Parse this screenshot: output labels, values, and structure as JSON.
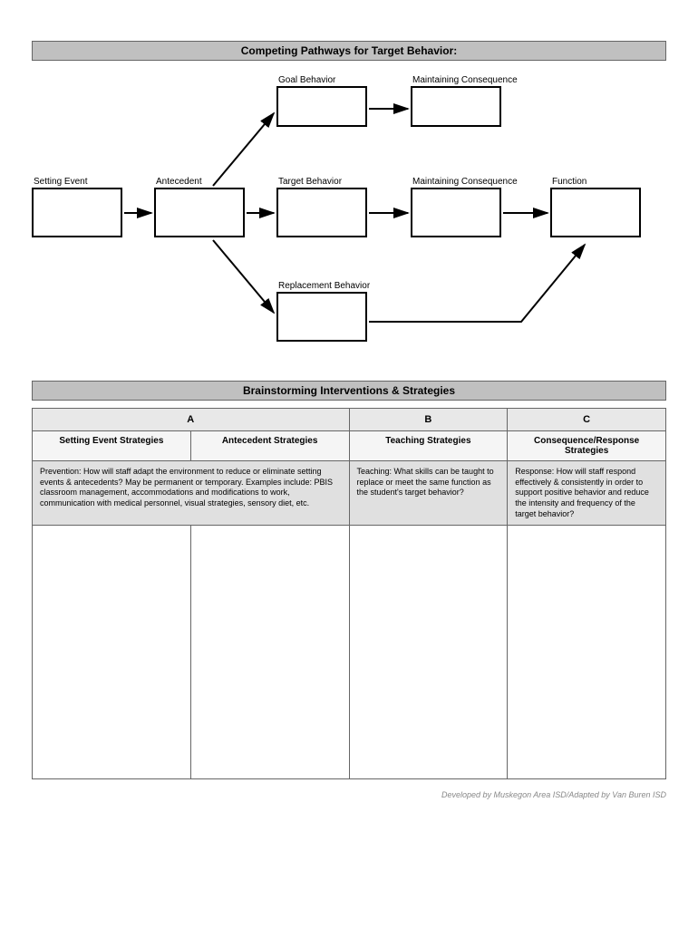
{
  "pathways": {
    "title": "Competing Pathways for Target Behavior:",
    "boxes": {
      "setting_event": "Setting Event",
      "antecedent": "Antecedent",
      "goal_behavior": "Goal Behavior",
      "target_behavior": "Target Behavior",
      "replacement_behavior": "Replacement Behavior",
      "maintaining_consequence_top": "Maintaining Consequence",
      "maintaining_consequence_mid": "Maintaining Consequence",
      "function": "Function"
    }
  },
  "strategies": {
    "title": "Brainstorming Interventions & Strategies",
    "cols": {
      "a": "A",
      "b": "B",
      "c": "C"
    },
    "subs": {
      "setting_event": "Setting Event Strategies",
      "antecedent": "Antecedent Strategies",
      "teaching": "Teaching Strategies",
      "consequence": "Consequence/Response Strategies"
    },
    "desc": {
      "prevention": "Prevention: How will staff adapt the environment to reduce or eliminate setting events & antecedents? May be permanent or temporary. Examples include: PBIS classroom management, accommodations and modifications to work, communication with medical personnel, visual strategies, sensory diet, etc.",
      "teaching": "Teaching: What skills can be taught to replace or meet the same function as the student's target behavior?",
      "response": "Response: How will staff respond effectively & consistently in order to support positive behavior and reduce the intensity and frequency of the target behavior?"
    }
  },
  "footer": "Developed by Muskegon Area ISD/Adapted by Van Buren ISD"
}
